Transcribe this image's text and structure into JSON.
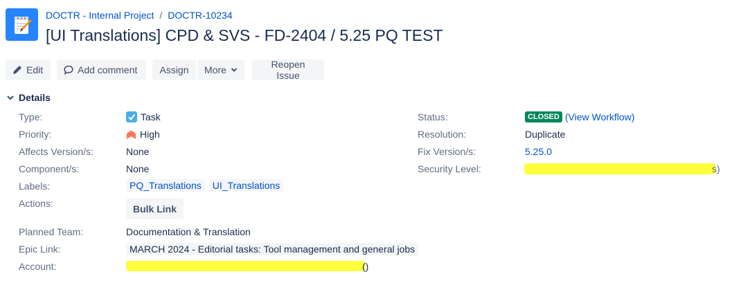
{
  "breadcrumb": {
    "project": "DOCTR - Internal Project",
    "separator": "/",
    "issue_key": "DOCTR-10234"
  },
  "issue": {
    "title": "[UI Translations] CPD & SVS - FD-2404 / 5.25 PQ TEST"
  },
  "toolbar": {
    "edit_label": "Edit",
    "add_comment_label": "Add comment",
    "assign_label": "Assign",
    "more_label": "More",
    "reopen_label": "Reopen Issue"
  },
  "details": {
    "header": "Details",
    "left": {
      "type": {
        "label": "Type:",
        "value": "Task"
      },
      "priority": {
        "label": "Priority:",
        "value": "High"
      },
      "affects_version": {
        "label": "Affects Version/s:",
        "value": "None"
      },
      "component": {
        "label": "Component/s:",
        "value": "None"
      },
      "labels": {
        "label": "Labels:",
        "values": [
          "PQ_Translations",
          "UI_Translations"
        ]
      },
      "actions": {
        "label": "Actions:",
        "button": "Bulk Link"
      },
      "planned_team": {
        "label": "Planned Team:",
        "value": "Documentation & Translation"
      },
      "epic_link": {
        "label": "Epic Link:",
        "value": "MARCH 2024 - Editorial tasks: Tool management and general jobs"
      },
      "account": {
        "label": "Account:",
        "trailing": "()"
      }
    },
    "right": {
      "status": {
        "label": "Status:",
        "value": "CLOSED",
        "workflow_link": "(View Workflow)"
      },
      "resolution": {
        "label": "Resolution:",
        "value": "Duplicate"
      },
      "fix_version": {
        "label": "Fix Version/s:",
        "value": "5.25.0"
      },
      "security_level": {
        "label": "Security Level:",
        "trailing": "s)"
      }
    }
  },
  "colors": {
    "accent": "#0052cc",
    "status_closed": "#00875a",
    "priority_high": "#ff7452",
    "redaction": "#ffff3d"
  },
  "icons": {
    "project_avatar": "notepad-pencil-icon",
    "edit": "pencil-icon",
    "comment": "speech-bubble-icon",
    "more": "chevron-down-icon",
    "details_toggle": "chevron-down-icon",
    "type_task": "checkbox-icon",
    "priority_high": "priority-high-icon"
  }
}
